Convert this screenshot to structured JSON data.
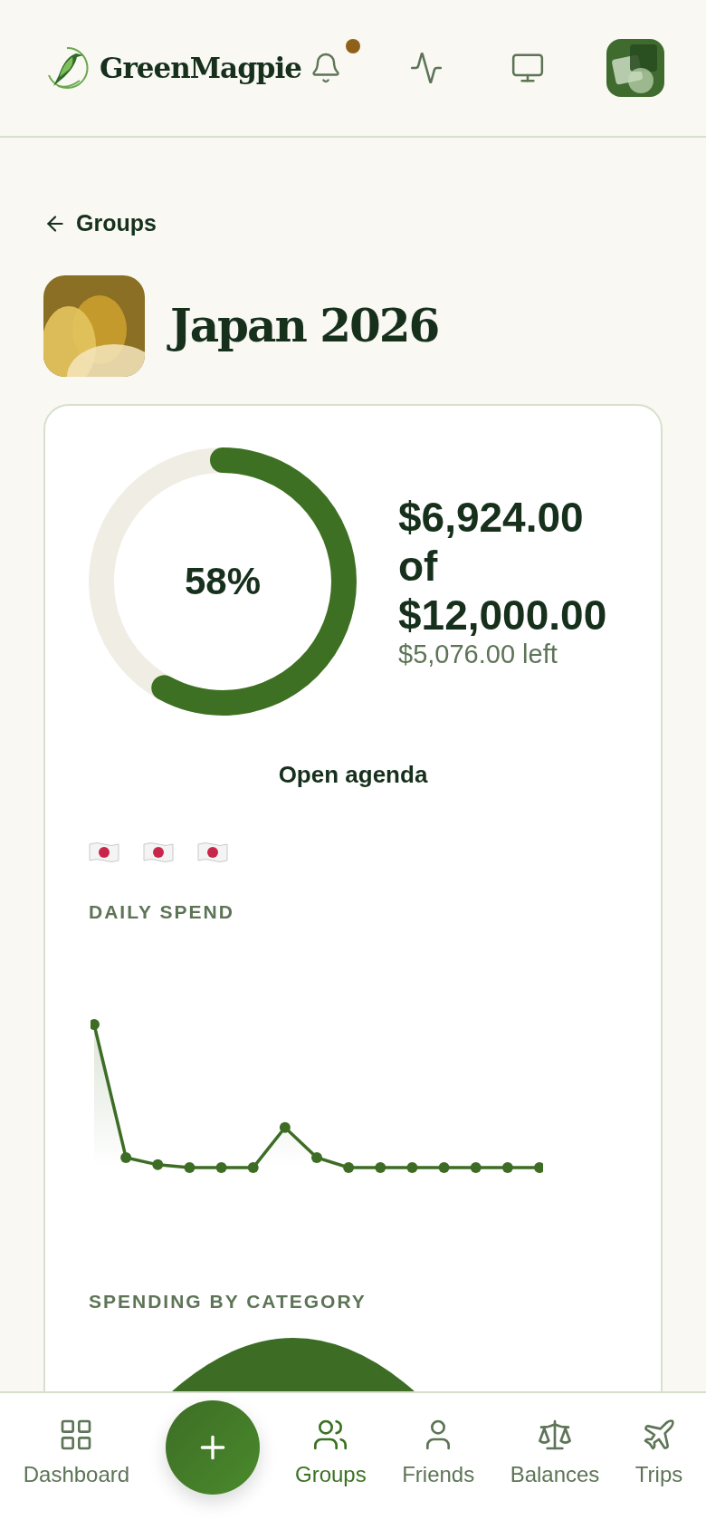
{
  "header": {
    "brand": "GreenMagpie",
    "notifications_unread": true
  },
  "back_link": "Groups",
  "group": {
    "title": "Japan 2026"
  },
  "budget": {
    "percent": "58%",
    "level": 0.58,
    "spent": "$6,924.00",
    "of": "of",
    "total": "$12,000.00",
    "left": "$5,076.00 left"
  },
  "agenda_link": "Open agenda",
  "daily_spend": {
    "title": "DAILY SPEND"
  },
  "spending_by_category": {
    "title": "SPENDING BY CATEGORY"
  },
  "nav": [
    {
      "kind": "tab",
      "label": "Dashboard",
      "selected": false
    },
    {
      "kind": "add"
    },
    {
      "kind": "tab",
      "label": "Groups",
      "selected": true
    },
    {
      "kind": "tab",
      "label": "Friends",
      "selected": false
    },
    {
      "kind": "tab",
      "label": "Balances",
      "selected": false
    },
    {
      "kind": "tab",
      "label": "Trips",
      "selected": false
    }
  ]
}
